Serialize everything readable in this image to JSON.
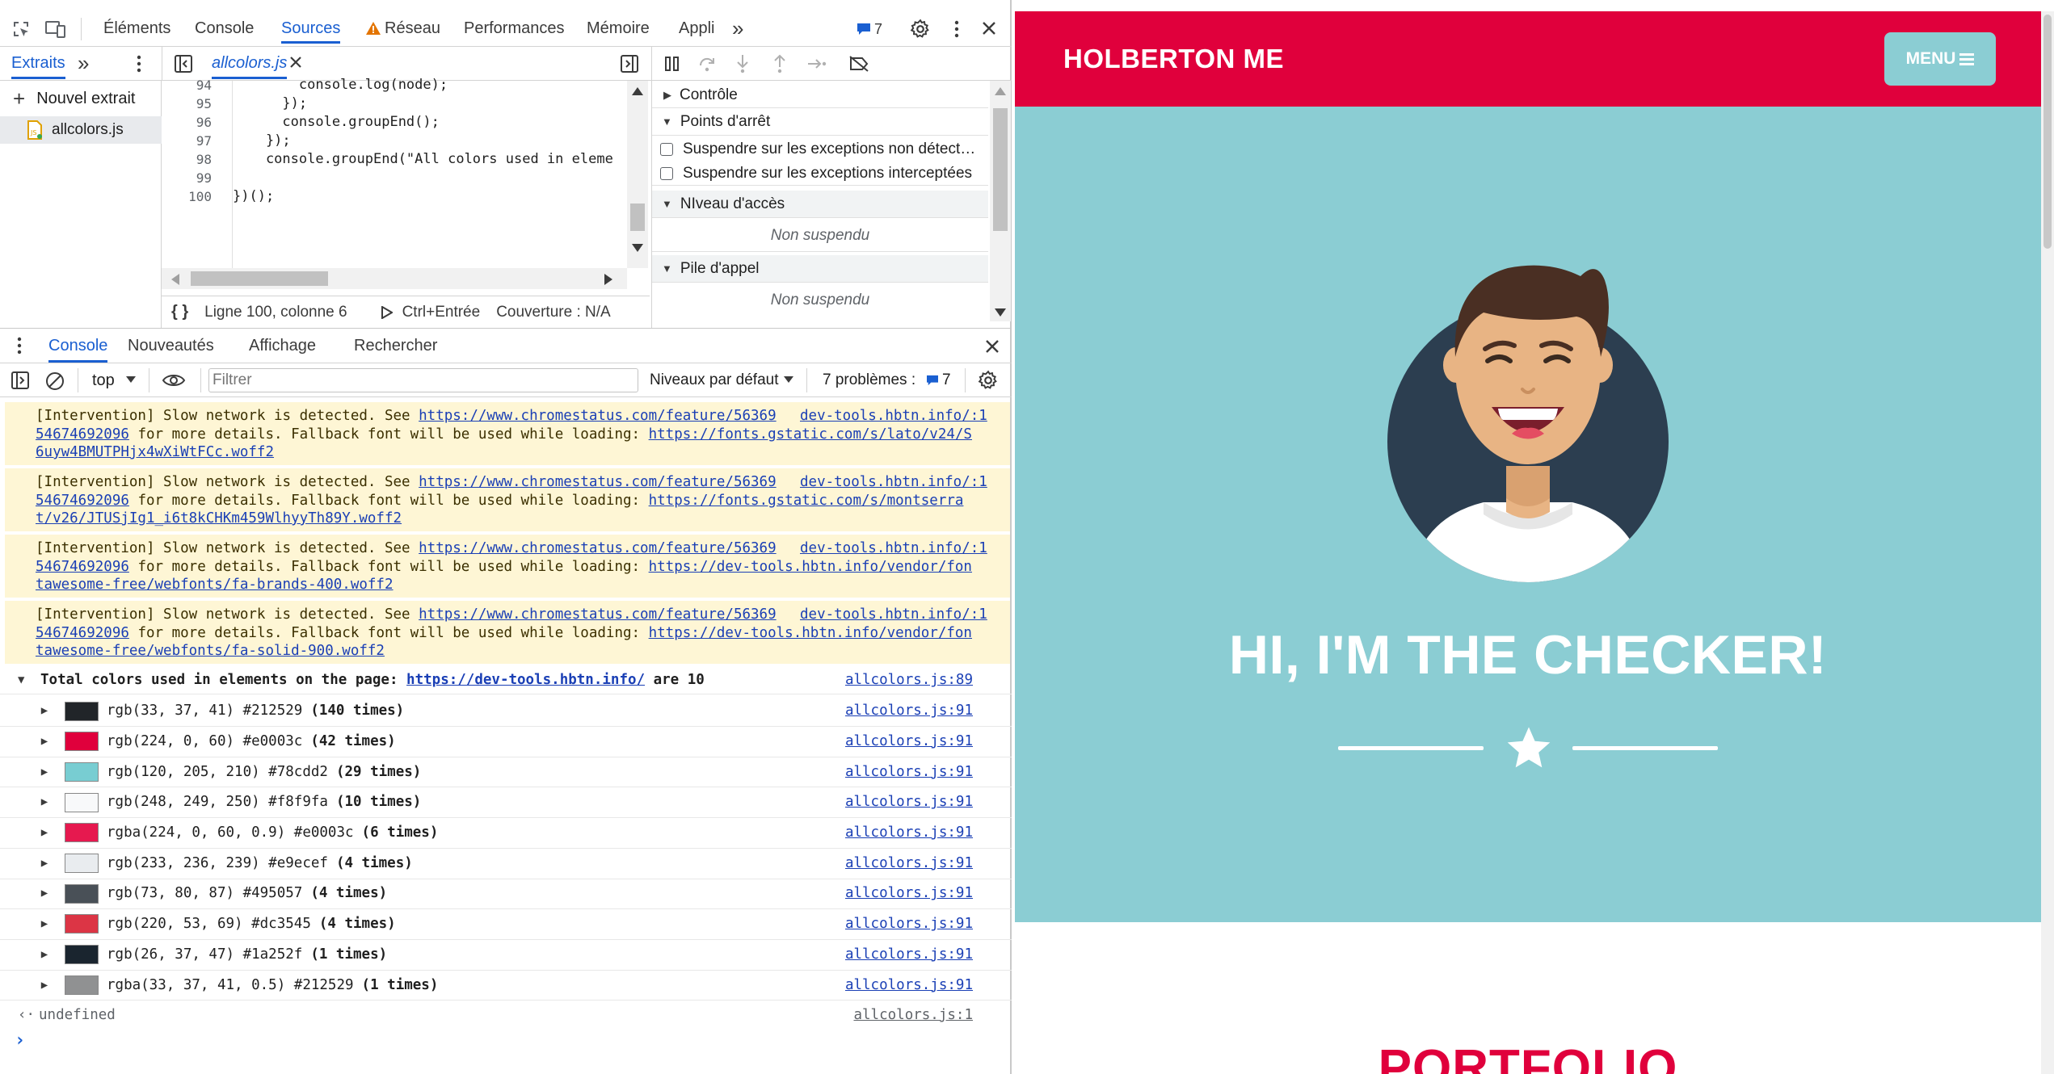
{
  "toolbar": {
    "tabs": [
      "Éléments",
      "Console",
      "Sources",
      "Réseau",
      "Performances",
      "Mémoire",
      "Appli"
    ],
    "more": "»",
    "issues_count": "7"
  },
  "sources": {
    "left_tab": "Extraits",
    "new_snippet": "Nouvel extrait",
    "file_item": "allcolors.js",
    "open_file_tab": "allcolors.js",
    "code_lines": [
      {
        "num": "94",
        "text": "        console.log(node);"
      },
      {
        "num": "95",
        "text": "      });"
      },
      {
        "num": "96",
        "text": "      console.groupEnd();"
      },
      {
        "num": "97",
        "text": "    });"
      },
      {
        "num": "98",
        "text": "    console.groupEnd(\"All colors used in elemen"
      },
      {
        "num": "99",
        "text": ""
      },
      {
        "num": "100",
        "text": "})();"
      }
    ],
    "status_position": "Ligne 100, colonne 6",
    "run_shortcut": "Ctrl+Entrée",
    "coverage": "Couverture : N/A",
    "debug": {
      "section_control": "Contrôle",
      "section_breakpoints": "Points d'arrêt",
      "cb_uncaught": "Suspendre sur les exceptions non détect…",
      "cb_caught": "Suspendre sur les exceptions interceptées",
      "section_scope": "NIveau d'accès",
      "scope_value": "Non suspendu",
      "section_callstack": "Pile d'appel",
      "callstack_value": "Non suspendu"
    }
  },
  "drawer": {
    "tabs": [
      "Console",
      "Nouveautés",
      "Affichage",
      "Rechercher"
    ],
    "context": "top",
    "filter_placeholder": "Filtrer",
    "levels": "Niveaux par défaut",
    "problems_label": "7 problèmes :",
    "problems_count": "7"
  },
  "console": {
    "warnings": [
      {
        "prefix": "[Intervention] Slow network is detected. See ",
        "link1": "https://www.chromestatus.com/feature/56369",
        "src_a": "dev-tools.hbtn.info/:1",
        "src_b": "54674692096",
        "mid": " for more details. Fallback font will be used while loading: ",
        "link2a": "https://fonts.gstatic.com/s/lato/v24/S",
        "link2b": "6uyw4BMUTPHjx4wXiWtFCc.woff2"
      },
      {
        "prefix": "[Intervention] Slow network is detected. See ",
        "link1": "https://www.chromestatus.com/feature/56369",
        "src_a": "dev-tools.hbtn.info/:1",
        "src_b": "54674692096",
        "mid": " for more details. Fallback font will be used while loading: ",
        "link2a": "https://fonts.gstatic.com/s/montserra",
        "link2b": "t/v26/JTUSjIg1_i6t8kCHKm459WlhyyTh89Y.woff2"
      },
      {
        "prefix": "[Intervention] Slow network is detected. See ",
        "link1": "https://www.chromestatus.com/feature/56369",
        "src_a": "dev-tools.hbtn.info/:1",
        "src_b": "54674692096",
        "mid": " for more details. Fallback font will be used while loading: ",
        "link2a": "https://dev-tools.hbtn.info/vendor/fon",
        "link2b": "tawesome-free/webfonts/fa-brands-400.woff2"
      },
      {
        "prefix": "[Intervention] Slow network is detected. See ",
        "link1": "https://www.chromestatus.com/feature/56369",
        "src_a": "dev-tools.hbtn.info/:1",
        "src_b": "54674692096",
        "mid": " for more details. Fallback font will be used while loading: ",
        "link2a": "https://dev-tools.hbtn.info/vendor/fon",
        "link2b": "tawesome-free/webfonts/fa-solid-900.woff2"
      }
    ],
    "group": {
      "prefix": "Total colors used in elements on the page: ",
      "link": "https://dev-tools.hbtn.info/",
      "suffix": " are 10",
      "source": "allcolors.js:89"
    },
    "colors": [
      {
        "swatch": "#212529",
        "label": "rgb(33, 37, 41) #212529",
        "count": "(140 times)",
        "source": "allcolors.js:91"
      },
      {
        "swatch": "#e0003c",
        "label": "rgb(224, 0, 60) #e0003c",
        "count": "(42 times)",
        "source": "allcolors.js:91"
      },
      {
        "swatch": "#78cdd2",
        "label": "rgb(120, 205, 210) #78cdd2",
        "count": "(29 times)",
        "source": "allcolors.js:91"
      },
      {
        "swatch": "#f8f9fa",
        "label": "rgb(248, 249, 250) #f8f9fa",
        "count": "(10 times)",
        "source": "allcolors.js:91"
      },
      {
        "swatch": "#e6194f",
        "label": "rgba(224, 0, 60, 0.9) #e0003c",
        "count": "(6 times)",
        "source": "allcolors.js:91"
      },
      {
        "swatch": "#e9ecef",
        "label": "rgb(233, 236, 239) #e9ecef",
        "count": "(4 times)",
        "source": "allcolors.js:91"
      },
      {
        "swatch": "#495057",
        "label": "rgb(73, 80, 87) #495057",
        "count": "(4 times)",
        "source": "allcolors.js:91"
      },
      {
        "swatch": "#dc3545",
        "label": "rgb(220, 53, 69) #dc3545",
        "count": "(4 times)",
        "source": "allcolors.js:91"
      },
      {
        "swatch": "#1a252f",
        "label": "rgb(26, 37, 47) #1a252f",
        "count": "(1 times)",
        "source": "allcolors.js:91"
      },
      {
        "swatch": "#909192",
        "label": "rgba(33, 37, 41, 0.5) #212529",
        "count": "(1 times)",
        "source": "allcolors.js:91"
      }
    ],
    "result": "undefined",
    "result_source": "allcolors.js:1",
    "prompt": "›"
  },
  "site": {
    "brand": "HOLBERTON ME",
    "menu_label": "MENU",
    "hero_title": "HI, I'M THE CHECKER!",
    "next_section_title": "PORTFOLIO",
    "colors": {
      "primary": "#e0003c",
      "hero": "#8bcdd3",
      "avatar_bg": "#2c3e50"
    }
  }
}
